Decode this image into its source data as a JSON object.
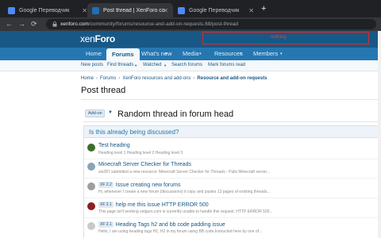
{
  "browser": {
    "tabs": [
      {
        "title": "Google Переводчик",
        "favicon_color": "#4c8bf5"
      },
      {
        "title": "Post thread | XenForo community",
        "favicon_color": "#1e6fb8"
      },
      {
        "title": "Google Переводчик",
        "favicon_color": "#4c8bf5"
      }
    ],
    "new_tab_glyph": "+",
    "url_host": "xenforo.com",
    "url_path": "/community/forums/resource-and-add-on-requests.68/post-thread"
  },
  "site": {
    "logo_pre": "xen",
    "logo_post": "Foro",
    "search_text": "nothing",
    "nav": [
      "Home",
      "Forums",
      "What's new",
      "Media",
      "Resources",
      "Members"
    ],
    "subnav": [
      "New posts",
      "Find threads",
      "Watched",
      "Search forums",
      "Mark forums read"
    ],
    "breadcrumb": [
      "Home",
      "Forums",
      "XenForo resources and add-ons",
      "Resource and add-on requests"
    ],
    "page_title": "Post thread"
  },
  "form": {
    "prefix_label": "Add-on",
    "thread_title": "Random thread in forum head",
    "similar_header": "Is this already being discussed?",
    "threads": [
      {
        "title": "Test heading",
        "tag": "",
        "snippet": "Heading level 1 Heading level 2 Heading level 3",
        "avatar_color": "#3a6e2a"
      },
      {
        "title": "Minecraft Server Checker for Threads",
        "tag": "",
        "snippet": "zei287 submitted a new resource: Minecraft Server Checker for Threads - Pulls Minecraft server...",
        "avatar_color": "#8aa3b5"
      },
      {
        "title": "Issue creating new forums",
        "tag": "XF 2.2",
        "snippet": "Hi, whenever I create a new forum (discussions) it copy and pastes 13 pages of existing threads...",
        "avatar_color": "#9e9e9e"
      },
      {
        "title": "help me this issue HTTP ERROR 500",
        "tag": "XF 2.1",
        "snippet": "This page isn't working vetgurs.com is currently unable to handle this request. HTTP ERROR 500...",
        "avatar_color": "#8c1f1f"
      },
      {
        "title": "Heading Tags h2 and bb code padding issue",
        "tag": "XF 2.1",
        "snippet": "Hello, I am using heading tags H1, H2 in my forum using BB code.Instructed here by one of...",
        "avatar_color": "#c9c9c9"
      }
    ]
  },
  "colors": {
    "header": "#185886",
    "nav": "#2577b1",
    "search_outline": "#d32f2f"
  }
}
